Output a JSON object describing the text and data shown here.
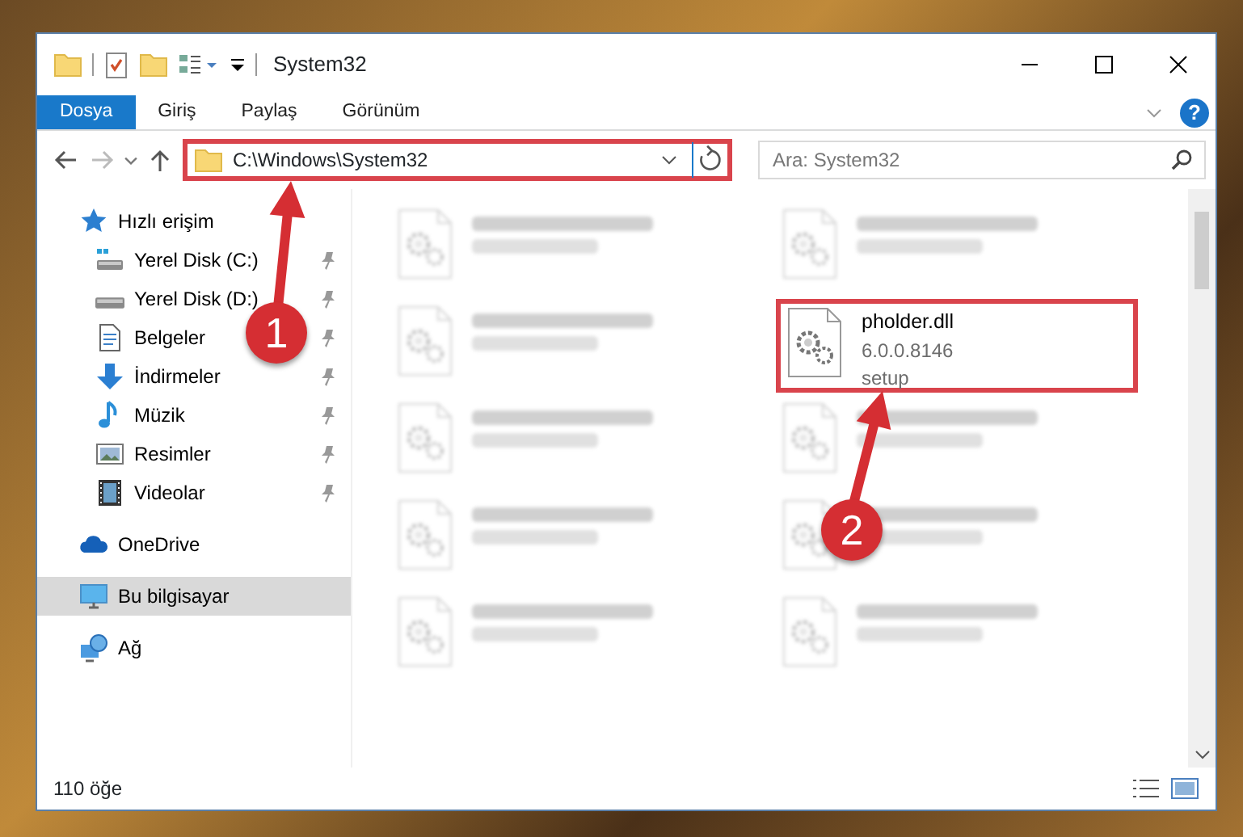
{
  "window": {
    "title": "System32"
  },
  "help": {
    "label": "?"
  },
  "ribbon_tabs": [
    {
      "label": "Dosya",
      "selected": true
    },
    {
      "label": "Giriş",
      "selected": false
    },
    {
      "label": "Paylaş",
      "selected": false
    },
    {
      "label": "Görünüm",
      "selected": false
    }
  ],
  "address_bar": {
    "path": "C:\\Windows\\System32",
    "highlighted": true
  },
  "search": {
    "placeholder": "Ara: System32"
  },
  "sidebar": {
    "items": [
      {
        "label": "Hızlı erişim",
        "kind": "quick",
        "selected": false,
        "children": [
          {
            "label": "Yerel Disk (C:)",
            "kind": "drive-c",
            "selected": false
          },
          {
            "label": "Yerel Disk (D:)",
            "kind": "drive",
            "selected": false
          },
          {
            "label": "Belgeler",
            "kind": "docs",
            "selected": false
          },
          {
            "label": "İndirmeler",
            "kind": "downloads",
            "selected": false
          },
          {
            "label": "Müzik",
            "kind": "music",
            "selected": false
          },
          {
            "label": "Resimler",
            "kind": "pictures",
            "selected": false
          },
          {
            "label": "Videolar",
            "kind": "videos",
            "selected": false
          }
        ]
      },
      {
        "label": "OneDrive",
        "kind": "cloud",
        "selected": false
      },
      {
        "label": "Bu bilgisayar",
        "kind": "pc",
        "selected": true
      },
      {
        "label": "Ağ",
        "kind": "network",
        "selected": false
      }
    ]
  },
  "files": [
    {
      "blurred": true,
      "highlighted": false
    },
    {
      "blurred": true,
      "highlighted": false
    },
    {
      "blurred": true,
      "highlighted": false
    },
    {
      "name": "pholder.dll",
      "lines": [
        "6.0.0.8146",
        "setup"
      ],
      "blurred": false,
      "highlighted": true
    },
    {
      "blurred": true,
      "highlighted": false
    },
    {
      "blurred": true,
      "highlighted": false
    },
    {
      "blurred": true,
      "highlighted": false
    },
    {
      "blurred": true,
      "highlighted": false
    },
    {
      "blurred": true,
      "highlighted": false
    },
    {
      "blurred": true,
      "highlighted": false
    }
  ],
  "status_bar": {
    "count": "110 öğe"
  },
  "annotations": [
    {
      "number": "1"
    },
    {
      "number": "2"
    }
  ]
}
